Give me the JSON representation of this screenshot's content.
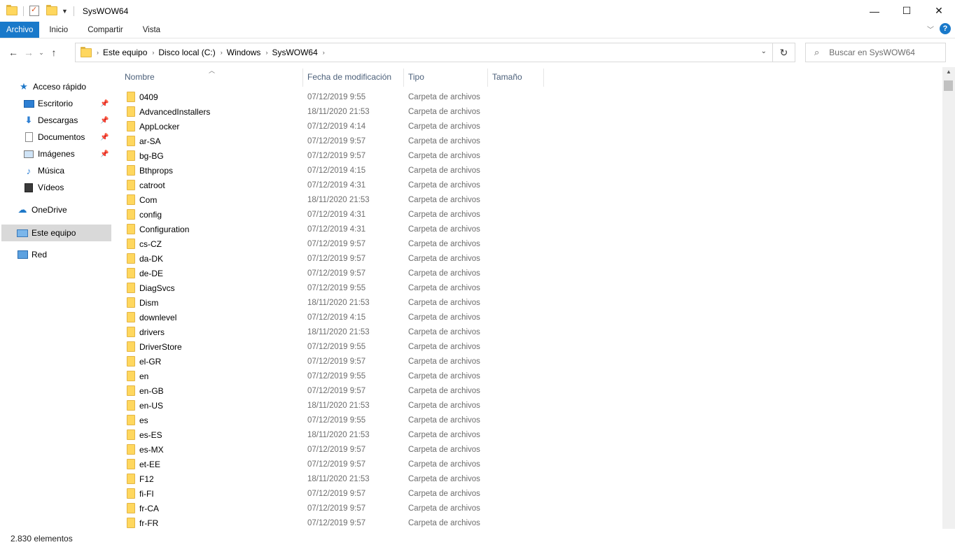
{
  "window": {
    "title": "SysWOW64",
    "controls": [
      "—",
      "☐",
      "✕"
    ]
  },
  "ribbon": {
    "tabs": [
      {
        "label": "Archivo",
        "active": true
      },
      {
        "label": "Inicio",
        "active": false
      },
      {
        "label": "Compartir",
        "active": false
      },
      {
        "label": "Vista",
        "active": false
      }
    ],
    "help_label": "?"
  },
  "address": {
    "crumbs": [
      "Este equipo",
      "Disco local (C:)",
      "Windows",
      "SysWOW64"
    ]
  },
  "search": {
    "placeholder": "Buscar en SysWOW64"
  },
  "nav": {
    "quick_access": "Acceso rápido",
    "items": [
      {
        "label": "Escritorio",
        "icon": "desktop-icon",
        "pinned": true
      },
      {
        "label": "Descargas",
        "icon": "downloads-icon",
        "pinned": true
      },
      {
        "label": "Documentos",
        "icon": "documents-icon",
        "pinned": true
      },
      {
        "label": "Imágenes",
        "icon": "pictures-icon",
        "pinned": true
      },
      {
        "label": "Música",
        "icon": "music-icon",
        "pinned": false
      },
      {
        "label": "Vídeos",
        "icon": "videos-icon",
        "pinned": false
      }
    ],
    "onedrive": "OneDrive",
    "this_pc": "Este equipo",
    "network": "Red"
  },
  "columns": {
    "name": "Nombre",
    "date": "Fecha de modificación",
    "type": "Tipo",
    "size": "Tamaño"
  },
  "files": [
    {
      "name": "0409",
      "date": "07/12/2019 9:55",
      "type": "Carpeta de archivos"
    },
    {
      "name": "AdvancedInstallers",
      "date": "18/11/2020 21:53",
      "type": "Carpeta de archivos"
    },
    {
      "name": "AppLocker",
      "date": "07/12/2019 4:14",
      "type": "Carpeta de archivos"
    },
    {
      "name": "ar-SA",
      "date": "07/12/2019 9:57",
      "type": "Carpeta de archivos"
    },
    {
      "name": "bg-BG",
      "date": "07/12/2019 9:57",
      "type": "Carpeta de archivos"
    },
    {
      "name": "Bthprops",
      "date": "07/12/2019 4:15",
      "type": "Carpeta de archivos"
    },
    {
      "name": "catroot",
      "date": "07/12/2019 4:31",
      "type": "Carpeta de archivos"
    },
    {
      "name": "Com",
      "date": "18/11/2020 21:53",
      "type": "Carpeta de archivos"
    },
    {
      "name": "config",
      "date": "07/12/2019 4:31",
      "type": "Carpeta de archivos"
    },
    {
      "name": "Configuration",
      "date": "07/12/2019 4:31",
      "type": "Carpeta de archivos"
    },
    {
      "name": "cs-CZ",
      "date": "07/12/2019 9:57",
      "type": "Carpeta de archivos"
    },
    {
      "name": "da-DK",
      "date": "07/12/2019 9:57",
      "type": "Carpeta de archivos"
    },
    {
      "name": "de-DE",
      "date": "07/12/2019 9:57",
      "type": "Carpeta de archivos"
    },
    {
      "name": "DiagSvcs",
      "date": "07/12/2019 9:55",
      "type": "Carpeta de archivos"
    },
    {
      "name": "Dism",
      "date": "18/11/2020 21:53",
      "type": "Carpeta de archivos"
    },
    {
      "name": "downlevel",
      "date": "07/12/2019 4:15",
      "type": "Carpeta de archivos"
    },
    {
      "name": "drivers",
      "date": "18/11/2020 21:53",
      "type": "Carpeta de archivos"
    },
    {
      "name": "DriverStore",
      "date": "07/12/2019 9:55",
      "type": "Carpeta de archivos"
    },
    {
      "name": "el-GR",
      "date": "07/12/2019 9:57",
      "type": "Carpeta de archivos"
    },
    {
      "name": "en",
      "date": "07/12/2019 9:55",
      "type": "Carpeta de archivos"
    },
    {
      "name": "en-GB",
      "date": "07/12/2019 9:57",
      "type": "Carpeta de archivos"
    },
    {
      "name": "en-US",
      "date": "18/11/2020 21:53",
      "type": "Carpeta de archivos"
    },
    {
      "name": "es",
      "date": "07/12/2019 9:55",
      "type": "Carpeta de archivos"
    },
    {
      "name": "es-ES",
      "date": "18/11/2020 21:53",
      "type": "Carpeta de archivos"
    },
    {
      "name": "es-MX",
      "date": "07/12/2019 9:57",
      "type": "Carpeta de archivos"
    },
    {
      "name": "et-EE",
      "date": "07/12/2019 9:57",
      "type": "Carpeta de archivos"
    },
    {
      "name": "F12",
      "date": "18/11/2020 21:53",
      "type": "Carpeta de archivos"
    },
    {
      "name": "fi-FI",
      "date": "07/12/2019 9:57",
      "type": "Carpeta de archivos"
    },
    {
      "name": "fr-CA",
      "date": "07/12/2019 9:57",
      "type": "Carpeta de archivos"
    },
    {
      "name": "fr-FR",
      "date": "07/12/2019 9:57",
      "type": "Carpeta de archivos"
    }
  ],
  "status": {
    "count": "2.830 elementos"
  },
  "colors": {
    "accent": "#1979ca",
    "folder": "#ffd75e",
    "selected_nav": "#d9d9d9"
  }
}
